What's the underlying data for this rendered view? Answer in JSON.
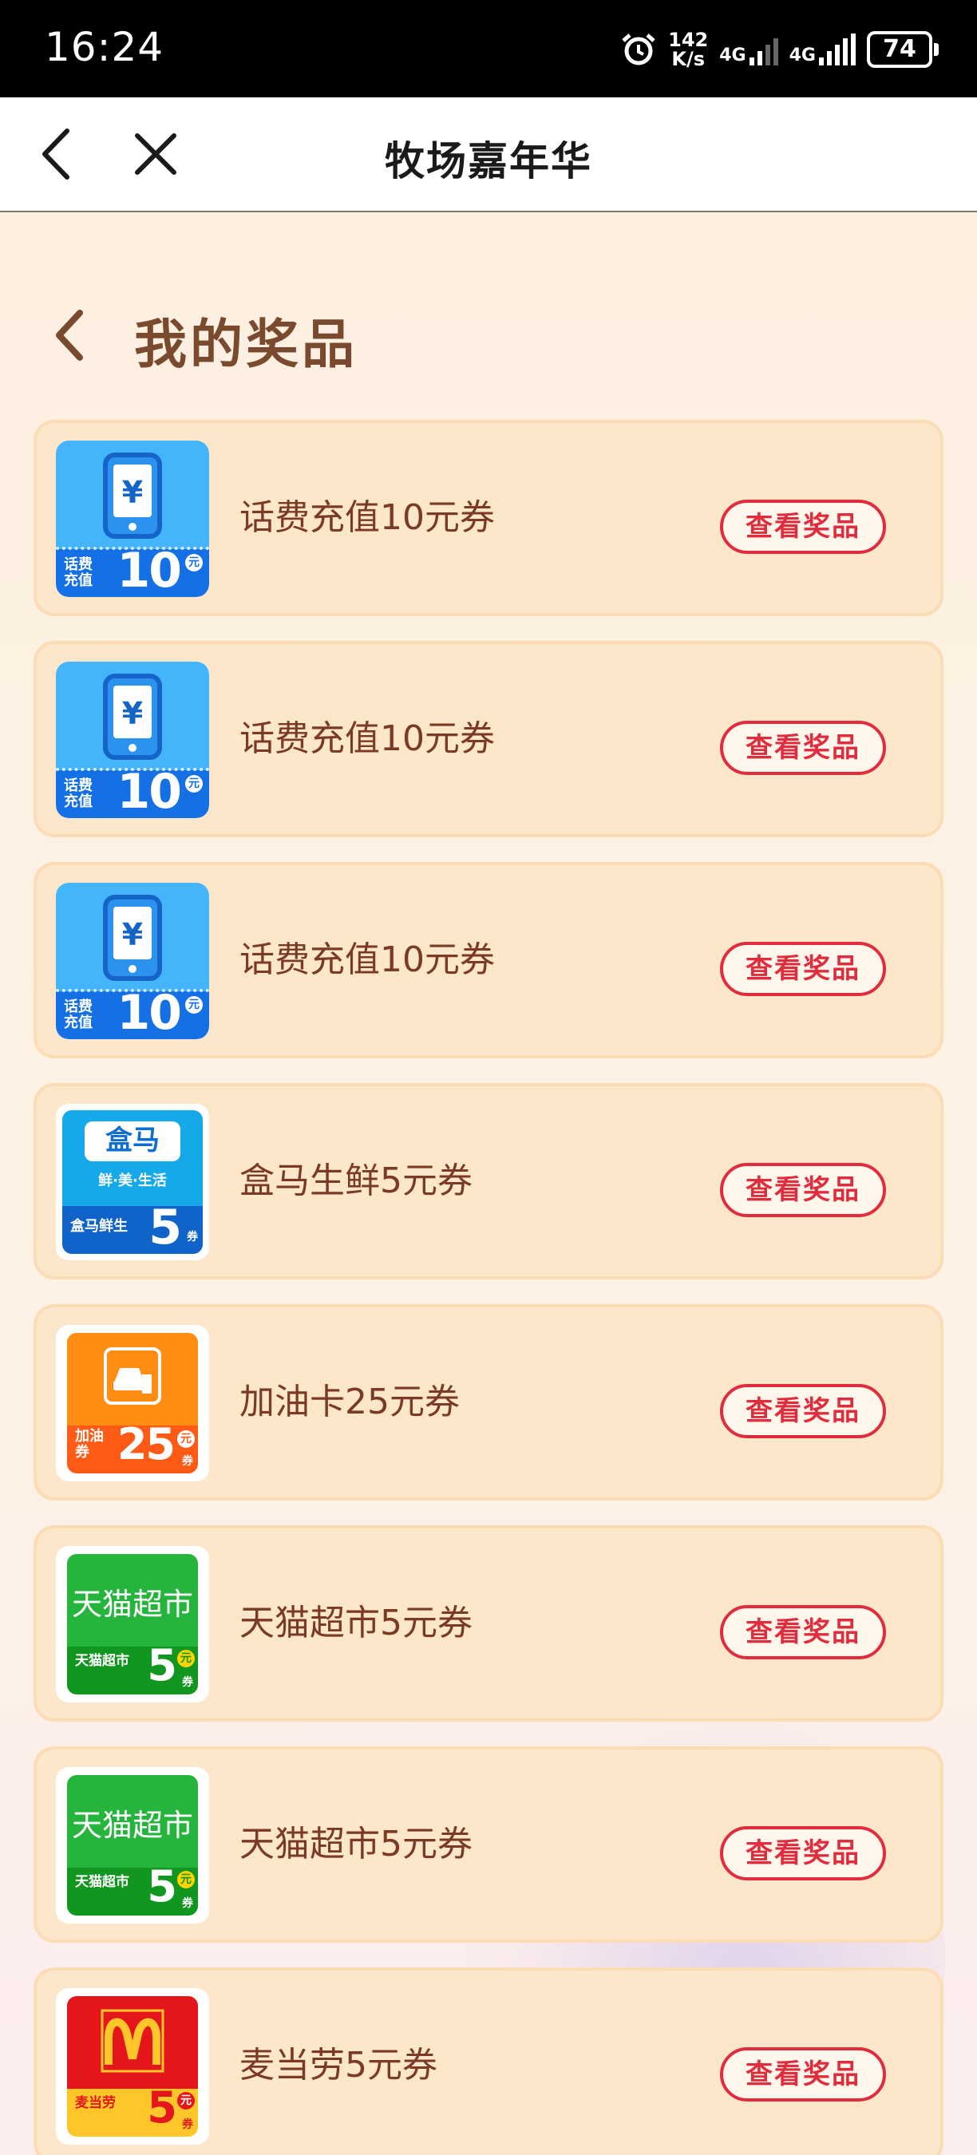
{
  "status_bar": {
    "time": "16:24",
    "speed_value": "142",
    "speed_unit": "K/s",
    "net1": "4G",
    "net2": "4G",
    "battery": "74"
  },
  "nav": {
    "title": "牧场嘉年华"
  },
  "section": {
    "title": "我的奖品"
  },
  "prizes": [
    {
      "name": "话费充值10元券",
      "button": "查看奖品",
      "icon": "phone-recharge-coupon-icon",
      "badge_label_1": "话费",
      "badge_label_2": "充值",
      "amount": "10",
      "unit": "元"
    },
    {
      "name": "话费充值10元券",
      "button": "查看奖品",
      "icon": "phone-recharge-coupon-icon",
      "badge_label_1": "话费",
      "badge_label_2": "充值",
      "amount": "10",
      "unit": "元"
    },
    {
      "name": "话费充值10元券",
      "button": "查看奖品",
      "icon": "phone-recharge-coupon-icon",
      "badge_label_1": "话费",
      "badge_label_2": "充值",
      "amount": "10",
      "unit": "元"
    },
    {
      "name": "盒马生鲜5元券",
      "button": "查看奖品",
      "icon": "hema-coupon-icon",
      "brand": "盒马",
      "slogan": "鲜·美·生活",
      "badge_label": "盒马鲜生",
      "amount": "5",
      "unit": "券"
    },
    {
      "name": "加油卡25元券",
      "button": "查看奖品",
      "icon": "fuel-card-coupon-icon",
      "badge_label_1": "加油",
      "badge_label_2": "券",
      "amount": "25",
      "unit": "元",
      "unit2": "券"
    },
    {
      "name": "天猫超市5元券",
      "button": "查看奖品",
      "icon": "tmall-supermarket-coupon-icon",
      "brand": "天猫超市",
      "badge_label": "天猫超市",
      "amount": "5",
      "unit": "元",
      "unit2": "券"
    },
    {
      "name": "天猫超市5元券",
      "button": "查看奖品",
      "icon": "tmall-supermarket-coupon-icon",
      "brand": "天猫超市",
      "badge_label": "天猫超市",
      "amount": "5",
      "unit": "元",
      "unit2": "券"
    },
    {
      "name": "麦当劳5元券",
      "button": "查看奖品",
      "icon": "mcdonalds-coupon-icon",
      "badge_label": "麦当劳",
      "amount": "5",
      "unit": "元",
      "unit2": "券"
    }
  ],
  "colors": {
    "card_bg": "#fde7cb",
    "button_red": "#e02c3c",
    "text_brown": "#7b3a24",
    "phone_blue": "#2d9ef4",
    "hema_blue": "#12a7e8",
    "fuel_orange": "#ff8a12",
    "tmall_green": "#22b43a",
    "mcd_red": "#e4161c",
    "mcd_yellow": "#ffc629"
  }
}
